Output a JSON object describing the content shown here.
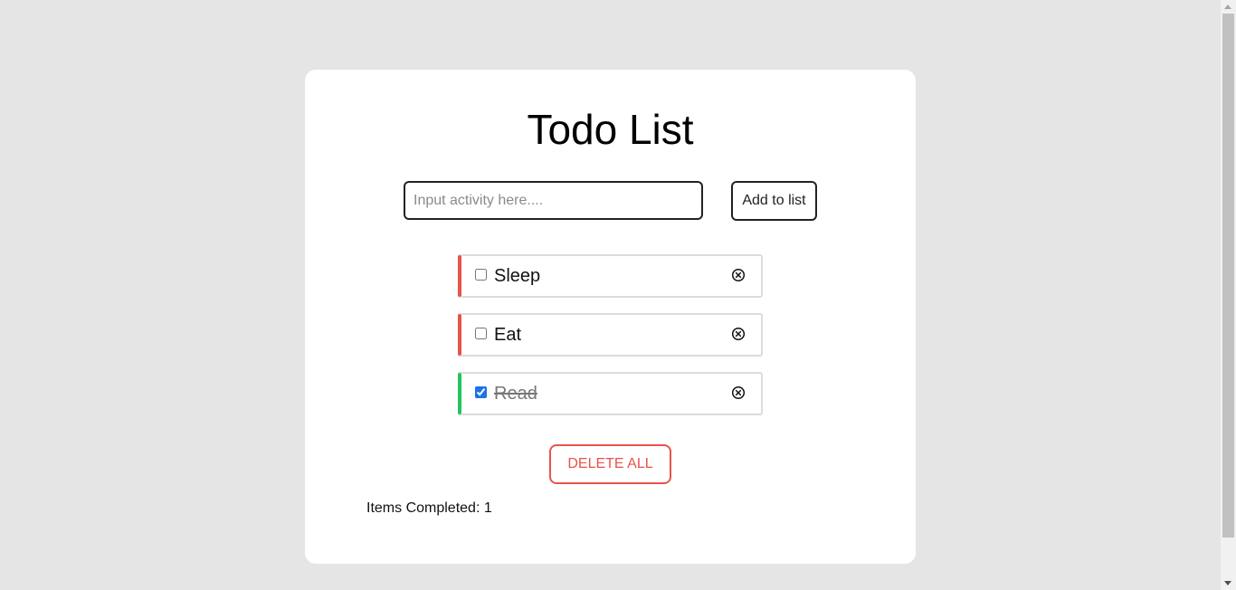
{
  "app": {
    "title": "Todo List"
  },
  "input": {
    "placeholder": "Input activity here....",
    "value": ""
  },
  "buttons": {
    "add_label": "Add to list",
    "delete_all_label": "DELETE ALL"
  },
  "todos": [
    {
      "label": "Sleep",
      "completed": false
    },
    {
      "label": "Eat",
      "completed": false
    },
    {
      "label": "Read",
      "completed": true
    }
  ],
  "icons": {
    "remove": "circled-x-icon"
  },
  "footer": {
    "completed_text": "Items Completed: 1"
  },
  "colors": {
    "background": "#e5e5e5",
    "card": "#ffffff",
    "pending_accent": "#e8534a",
    "done_accent": "#22c55e",
    "delete_all": "#e8534a"
  }
}
